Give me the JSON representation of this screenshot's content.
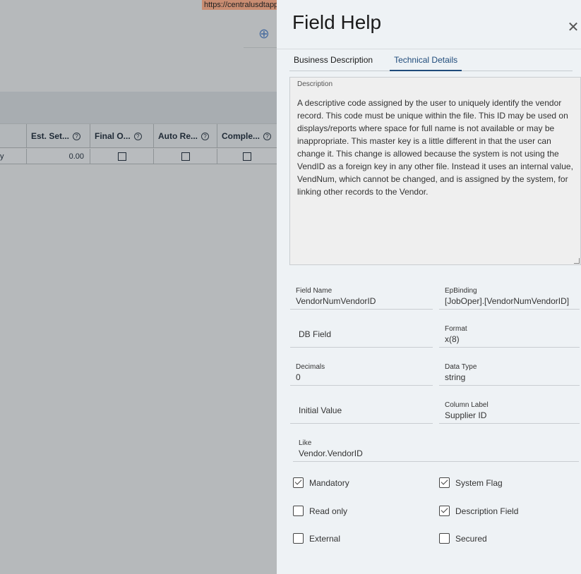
{
  "background": {
    "url_text": "https://centralusdtapp",
    "grid": {
      "columns": [
        {
          "label": "",
          "help": false
        },
        {
          "label": "Est. Set...",
          "help": true
        },
        {
          "label": "Final O...",
          "help": true
        },
        {
          "label": "Auto Re...",
          "help": true
        },
        {
          "label": "Comple...",
          "help": true
        }
      ],
      "row": {
        "first_cell": "y",
        "est_setup": "0.00"
      }
    }
  },
  "panel": {
    "title": "Field Help",
    "close_icon": "close-icon",
    "tabs": [
      {
        "label": "Business Description",
        "active": false
      },
      {
        "label": "Technical Details",
        "active": true
      }
    ],
    "description": {
      "label": "Description",
      "text": "A descriptive code assigned by the user to uniquely identify the vendor record.  This code must be unique within the file.  This ID may be used on displays/reports where space for full name is not available or may be inappropriate. This master key is a little different in that the user can change it.  This change is allowed because the system is not using the VendID as a foreign key in any other file. Instead it uses an internal value, VendNum, which cannot be changed, and is assigned by the system, for linking other records to the Vendor."
    },
    "fields": {
      "field_name": {
        "label": "Field Name",
        "value": "VendorNumVendorID"
      },
      "ep_binding": {
        "label": "EpBinding",
        "value": "[JobOper].[VendorNumVendorID]"
      },
      "db_field": {
        "label": "DB Field",
        "value": ""
      },
      "format": {
        "label": "Format",
        "value": "x(8)"
      },
      "decimals": {
        "label": "Decimals",
        "value": "0"
      },
      "data_type": {
        "label": "Data Type",
        "value": "string"
      },
      "initial_value": {
        "label": "Initial Value",
        "value": ""
      },
      "column_label": {
        "label": "Column Label",
        "value": "Supplier ID"
      },
      "like": {
        "label": "Like",
        "value": "Vendor.VendorID"
      }
    },
    "checkboxes": {
      "mandatory": {
        "label": "Mandatory",
        "checked": true
      },
      "system_flag": {
        "label": "System Flag",
        "checked": true
      },
      "read_only": {
        "label": "Read only",
        "checked": false
      },
      "description_field": {
        "label": "Description Field",
        "checked": true
      },
      "external": {
        "label": "External",
        "checked": false
      },
      "secured": {
        "label": "Secured",
        "checked": false
      }
    }
  }
}
